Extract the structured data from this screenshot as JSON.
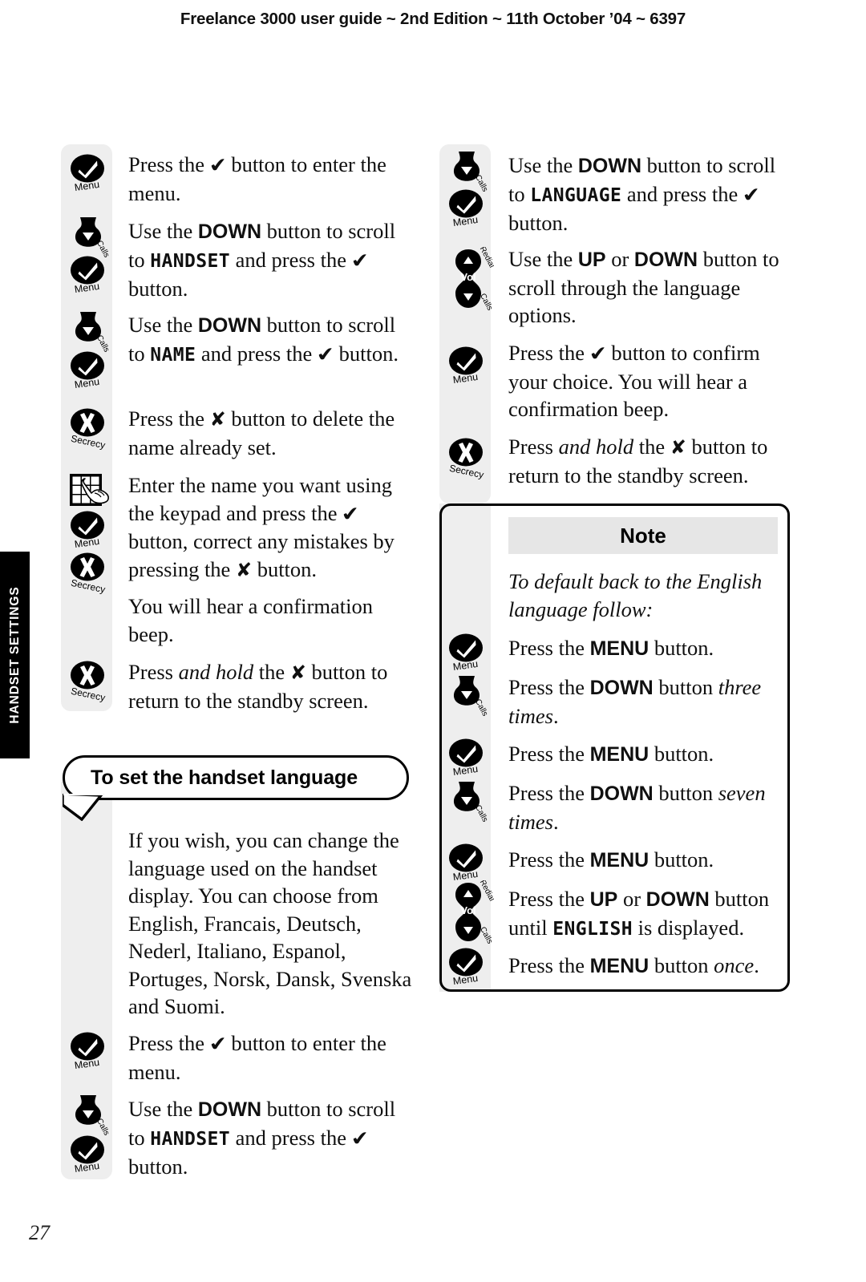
{
  "header": {
    "running_head": "Freelance 3000 user guide ~ 2nd Edition ~ 11th October ’04 ~ 6397"
  },
  "thumb_tab": {
    "label": "HANDSET SETTINGS"
  },
  "page_number": "27",
  "icons": {
    "menu": {
      "label": "Menu",
      "glyph": "check-icon"
    },
    "calls": {
      "label": "Calls",
      "glyph": "down-arrow-icon"
    },
    "secrecy": {
      "label": "Secrecy",
      "glyph": "cross-icon"
    },
    "keypad": {
      "label": "",
      "glyph": "keypad-hand-icon"
    },
    "vol": {
      "label": "Vol",
      "label_top": "Redial",
      "label_bottom": "Calls",
      "glyph": "volume-rocker-icon"
    }
  },
  "left_column": {
    "steps": [
      {
        "icons": [
          "menu"
        ],
        "text_html": "Press the <span class=\"gl gl-check\">&#10004;</span> button to enter the menu."
      },
      {
        "icons": [
          "calls",
          "menu"
        ],
        "text_html": "Use the <b>DOWN</b> button to scroll to <span class=\"lcd\">HANDSET</span> and press the <span class=\"gl gl-check\">&#10004;</span> button."
      },
      {
        "icons": [
          "calls",
          "menu"
        ],
        "text_html": "Use the <b>DOWN</b> button to scroll to <span class=\"lcd\">NAME</span> and press the <span class=\"gl gl-check\">&#10004;</span> button."
      },
      {
        "icons": [
          "secrecy"
        ],
        "text_html": "Press the <span class=\"gl\">&#10008;</span> button to delete the name already set."
      },
      {
        "icons": [
          "keypad",
          "menu",
          "secrecy"
        ],
        "text_html": "Enter the name you want using the keypad and press the <span class=\"gl gl-check\">&#10004;</span> button, correct any mistakes by pressing the <span class=\"gl\">&#10008;</span> button."
      },
      {
        "icons": [],
        "text_html": "You will hear a confirmation beep."
      },
      {
        "icons": [
          "secrecy"
        ],
        "text_html": "Press <i>and hold</i> the <span class=\"gl\">&#10008;</span> button to return to the standby screen."
      }
    ],
    "callout_heading": "To set the handset language",
    "language_steps": [
      {
        "icons": [],
        "text_html": "If you wish, you can change the language used on the handset display. You can choose from English, Francais, Deutsch, Nederl, Italiano, Espanol, Portuges, Norsk, Dansk, Svenska and Suomi."
      },
      {
        "icons": [
          "menu"
        ],
        "text_html": "Press the <span class=\"gl gl-check\">&#10004;</span> button to enter the menu."
      },
      {
        "icons": [
          "calls",
          "menu"
        ],
        "text_html": "Use the <b>DOWN</b> button to scroll to <span class=\"lcd\">HANDSET</span> and press the <span class=\"gl gl-check\">&#10004;</span> button."
      }
    ],
    "languages": [
      "English",
      "Francais",
      "Deutsch",
      "Nederl",
      "Italiano",
      "Espanol",
      "Portuges",
      "Norsk",
      "Dansk",
      "Svenska",
      "Suomi"
    ]
  },
  "right_column": {
    "steps": [
      {
        "icons": [
          "calls",
          "menu"
        ],
        "text_html": "Use the <b>DOWN</b> button to scroll to <span class=\"lcd\">LANGUAGE</span> and press the <span class=\"gl gl-check\">&#10004;</span> button."
      },
      {
        "icons": [
          "vol"
        ],
        "text_html": "Use the <b>UP</b> or <b>DOWN</b> button to scroll through the language options."
      },
      {
        "icons": [
          "menu"
        ],
        "text_html": "Press the <span class=\"gl gl-check\">&#10004;</span> button to confirm your choice. You will hear a confirmation beep."
      },
      {
        "icons": [
          "secrecy"
        ],
        "text_html": "Press <i>and hold</i> the <span class=\"gl\">&#10008;</span> button to return to the standby screen."
      }
    ]
  },
  "note": {
    "title": "Note",
    "intro_html": "<i>To default back to the English language follow:</i>",
    "steps": [
      {
        "icons": [
          "menu"
        ],
        "text_html": "Press the <b>MENU</b> button."
      },
      {
        "icons": [
          "calls"
        ],
        "text_html": "Press the <b>DOWN</b> button <i>three times</i>."
      },
      {
        "icons": [
          "menu"
        ],
        "text_html": "Press the <b>MENU</b> button."
      },
      {
        "icons": [
          "calls"
        ],
        "text_html": "Press the <b>DOWN</b> button <i>seven times</i>."
      },
      {
        "icons": [
          "menu"
        ],
        "text_html": "Press the <b>MENU</b> button."
      },
      {
        "icons": [
          "vol"
        ],
        "text_html": "Press the <b>UP</b> or <b>DOWN</b> button until <span class=\"lcd\">ENGLISH</span> is displayed."
      },
      {
        "icons": [
          "menu"
        ],
        "text_html": "Press the <b>MENU</b> button <i>once</i>."
      }
    ]
  },
  "colors": {
    "rail_grey": "#eeeeee",
    "note_header_grey": "#e6e6e6",
    "tab_black": "#000000",
    "text": "#101010"
  }
}
